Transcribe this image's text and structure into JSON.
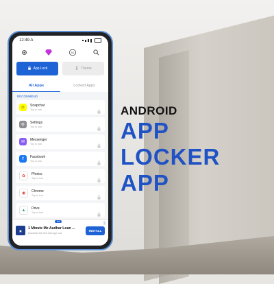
{
  "headline": {
    "line1": "ANDROID",
    "line2": "APP LOCKER",
    "line3": "APP"
  },
  "status": {
    "time": "12:49",
    "indicator": "A"
  },
  "top_icons": [
    "gear-icon",
    "diamond-icon",
    "ad-free-icon",
    "search-icon"
  ],
  "modes": {
    "app_lock": "App Lock",
    "theme": "Theme"
  },
  "tabs": {
    "all": "All Apps",
    "locked": "Locked Apps"
  },
  "section": "RECOMMEND",
  "apps": [
    {
      "name": "Snapchat",
      "sub": "Tap to lock",
      "color": "#fffc00",
      "glyph": "☺",
      "glyph_color": "#222"
    },
    {
      "name": "Settings",
      "sub": "Tap to lock",
      "color": "#8e8e93",
      "glyph": "⚙",
      "glyph_color": "#fff"
    },
    {
      "name": "Messenger",
      "sub": "Tap to lock",
      "color": "#8a5cf6",
      "glyph": "✉",
      "glyph_color": "#fff"
    },
    {
      "name": "Facebook",
      "sub": "Tap to lock",
      "color": "#1877f2",
      "glyph": "f",
      "glyph_color": "#fff"
    },
    {
      "name": "Photos",
      "sub": "Tap to lock",
      "color": "#ffffff",
      "glyph": "✿",
      "glyph_color": "#ea4335"
    },
    {
      "name": "Chrome",
      "sub": "Tap to lock",
      "color": "#ffffff",
      "glyph": "◉",
      "glyph_color": "#db4437"
    },
    {
      "name": "Drive",
      "sub": "Tap to lock",
      "color": "#ffffff",
      "glyph": "▲",
      "glyph_color": "#1fa463"
    }
  ],
  "ad": {
    "badge": "Ad",
    "title": "1 Minute Me Aadhar Loan ...",
    "subtitle": "Download the best loan app now",
    "cta": "INSTALL",
    "info": "ⓘ"
  },
  "colors": {
    "accent": "#1e63d6",
    "headline": "#1f52c4"
  }
}
